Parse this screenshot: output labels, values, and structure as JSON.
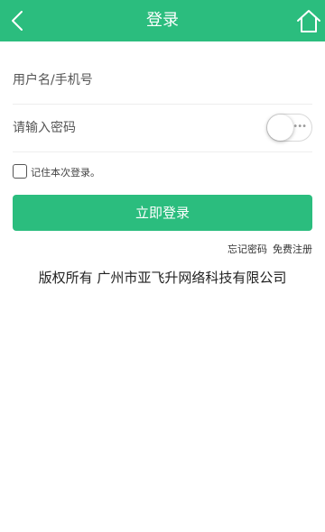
{
  "header": {
    "title": "登录",
    "back_icon": "chevron-left-icon",
    "home_icon": "home-icon"
  },
  "form": {
    "username_placeholder": "用户名/手机号",
    "password_placeholder": "请输入密码",
    "password_visible": false,
    "remember_label": "记住本次登录。",
    "remember_checked": false,
    "login_label": "立即登录"
  },
  "links": {
    "forgot_password": "忘记密码",
    "register": "免费注册"
  },
  "footer": {
    "copyright": "版权所有 广州市亚飞升网络科技有限公司"
  },
  "colors": {
    "accent": "#2bbd7e"
  }
}
